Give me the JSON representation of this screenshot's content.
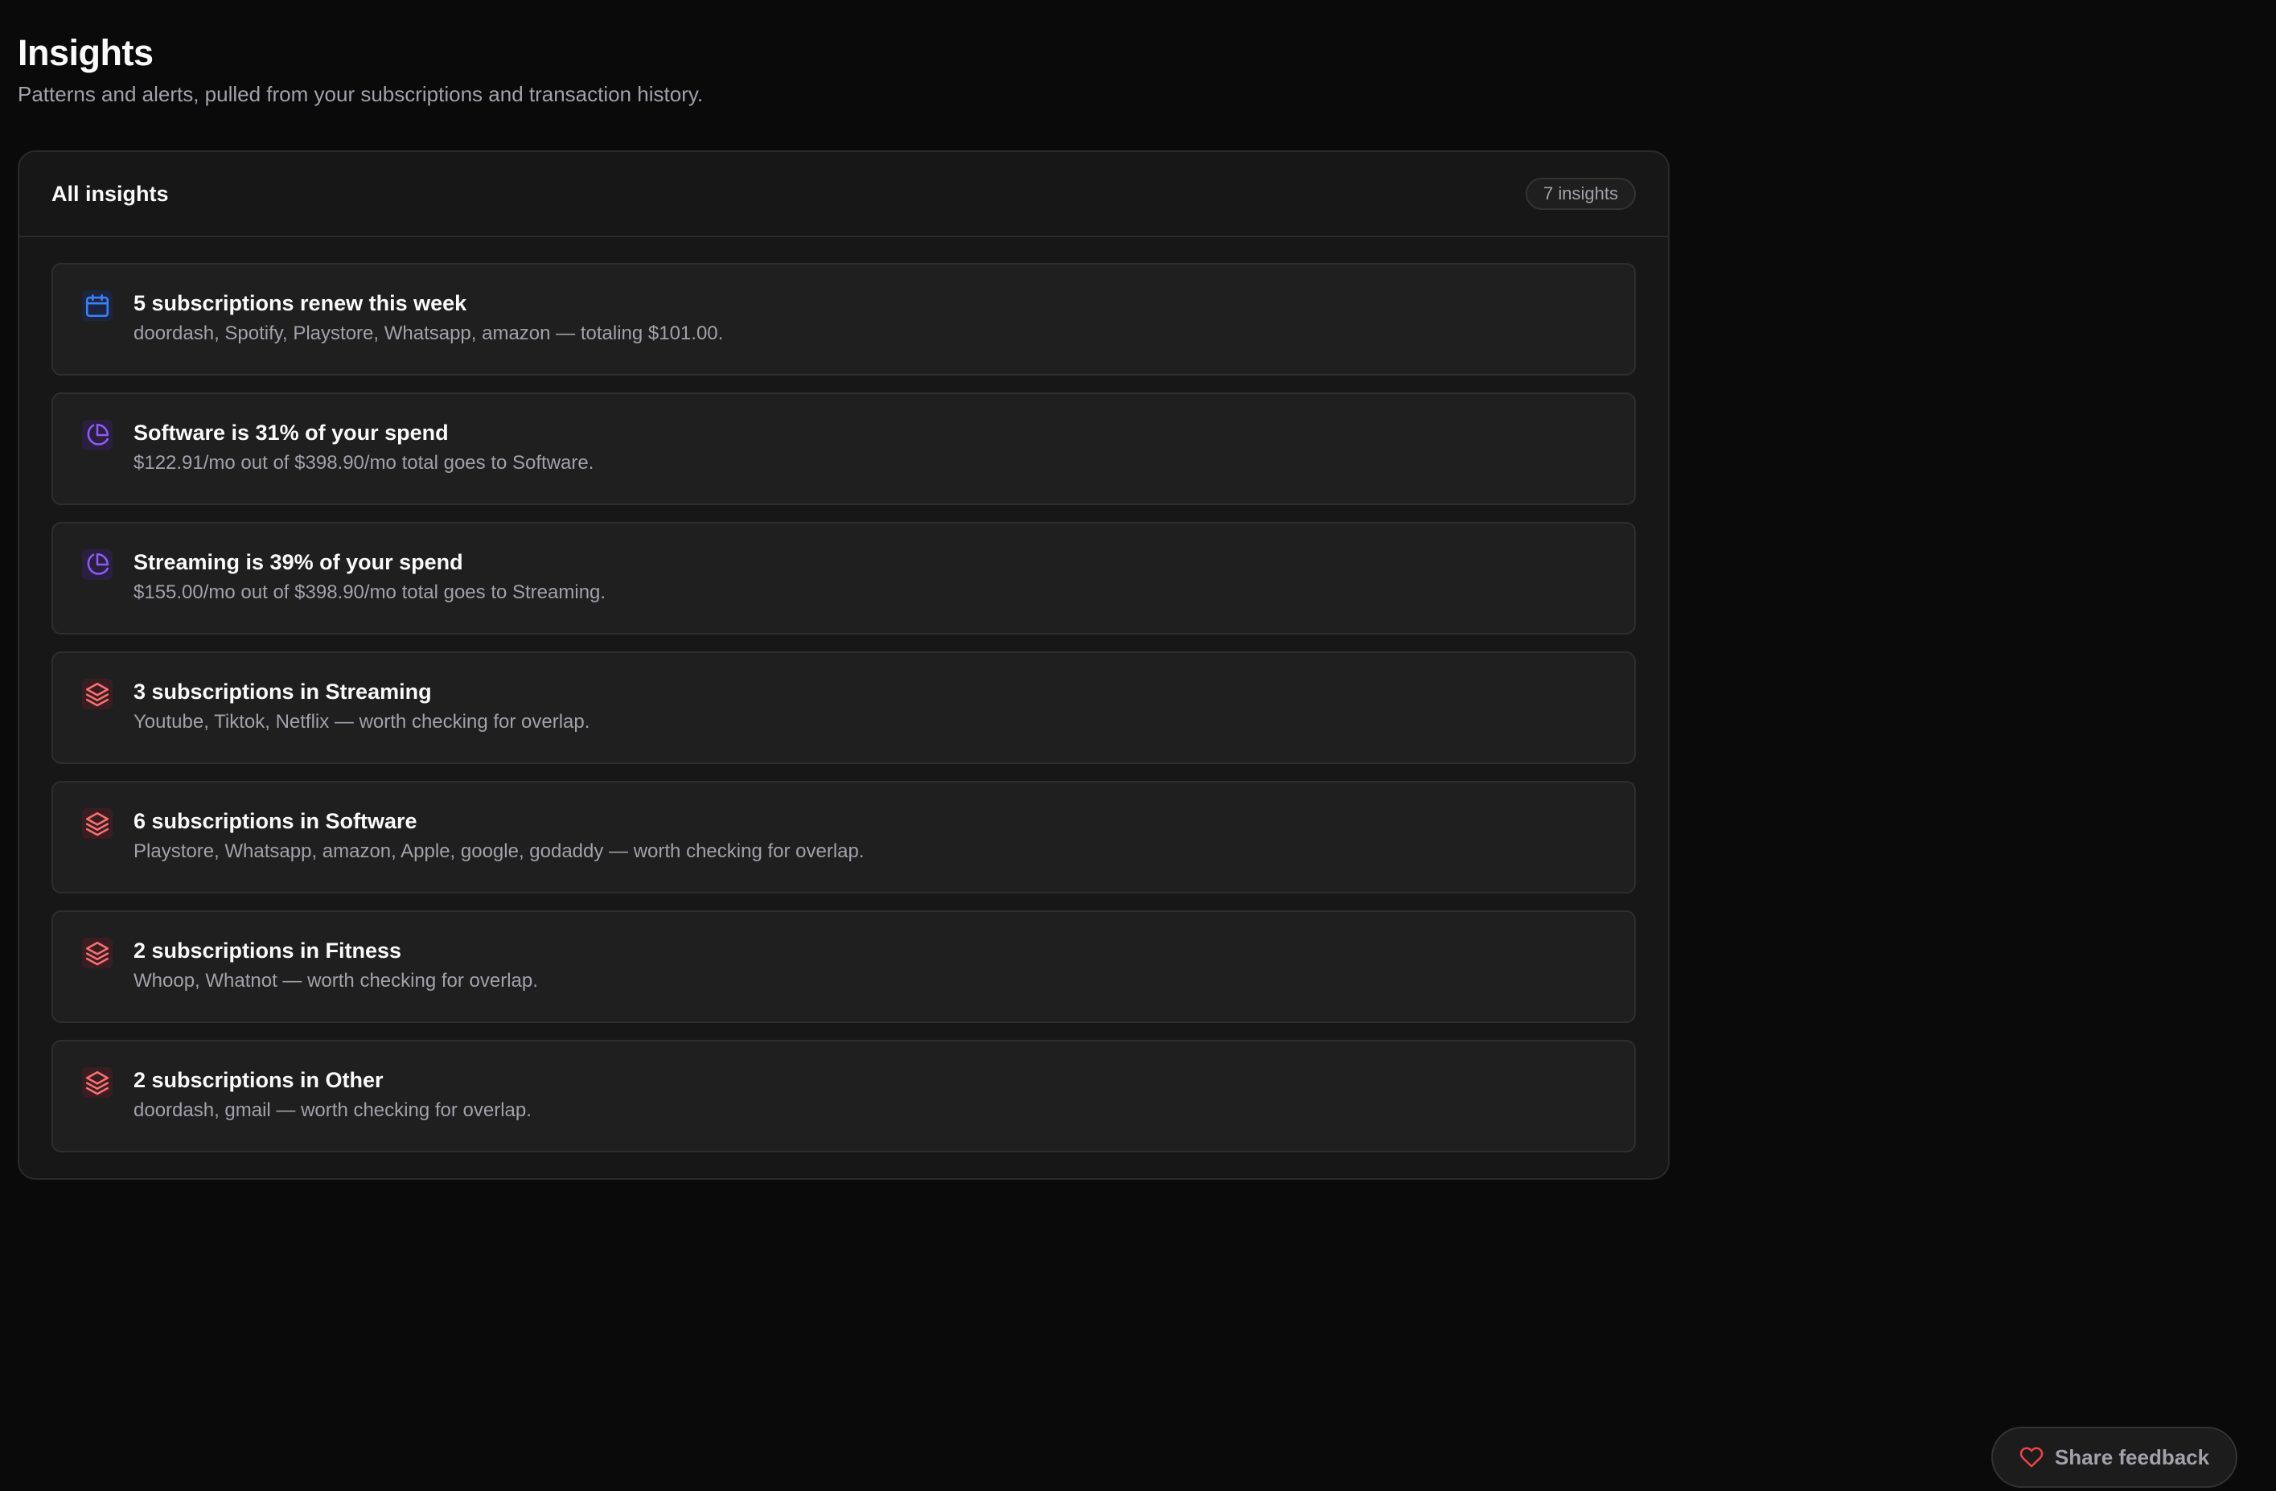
{
  "page": {
    "title": "Insights",
    "subtitle": "Patterns and alerts, pulled from your subscriptions and transaction history."
  },
  "card": {
    "title": "All insights",
    "count_label": "7 insights"
  },
  "insights": [
    {
      "icon": "calendar-icon",
      "color": "#3b82f6",
      "title": "5 subscriptions renew this week",
      "description": "doordash, Spotify, Playstore, Whatsapp, amazon — totaling $101.00."
    },
    {
      "icon": "pie-chart-icon",
      "color": "#8b5cf6",
      "title": "Software is 31% of your spend",
      "description": "$122.91/mo out of $398.90/mo total goes to Software."
    },
    {
      "icon": "pie-chart-icon",
      "color": "#8b5cf6",
      "title": "Streaming is 39% of your spend",
      "description": "$155.00/mo out of $398.90/mo total goes to Streaming."
    },
    {
      "icon": "layers-icon",
      "color": "#f87171",
      "title": "3 subscriptions in Streaming",
      "description": "Youtube, Tiktok, Netflix — worth checking for overlap."
    },
    {
      "icon": "layers-icon",
      "color": "#f87171",
      "title": "6 subscriptions in Software",
      "description": "Playstore, Whatsapp, amazon, Apple, google, godaddy — worth checking for overlap."
    },
    {
      "icon": "layers-icon",
      "color": "#f87171",
      "title": "2 subscriptions in Fitness",
      "description": "Whoop, Whatnot — worth checking for overlap."
    },
    {
      "icon": "layers-icon",
      "color": "#f87171",
      "title": "2 subscriptions in Other",
      "description": "doordash, gmail — worth checking for overlap."
    }
  ],
  "feedback": {
    "label": "Share feedback",
    "icon": "heart-icon",
    "icon_color": "#ef4444"
  }
}
